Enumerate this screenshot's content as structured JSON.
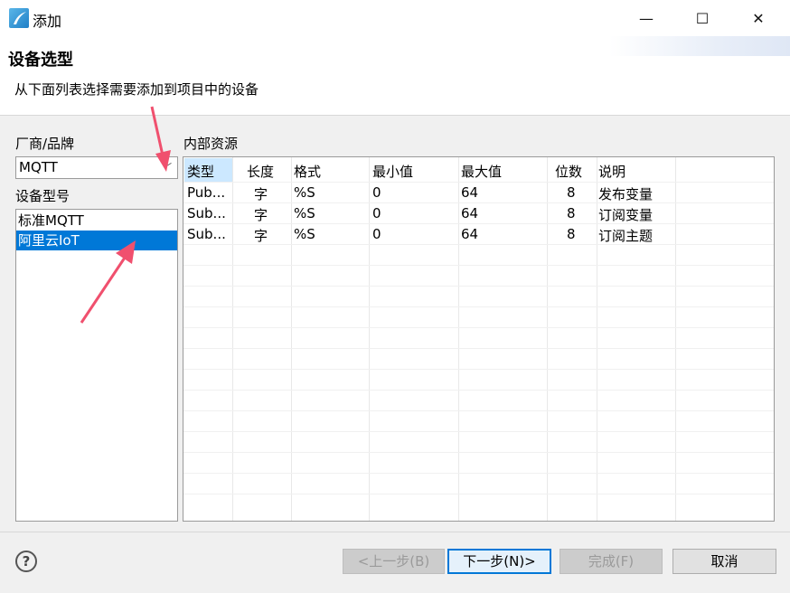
{
  "window": {
    "title": "添加",
    "min": "—",
    "max": "☐",
    "close": "✕"
  },
  "header": {
    "title": "设备选型",
    "description": "从下面列表选择需要添加到项目中的设备"
  },
  "vendor": {
    "label": "厂商/品牌",
    "selected": "MQTT"
  },
  "model": {
    "label": "设备型号",
    "items": [
      "标准MQTT",
      "阿里云IoT"
    ],
    "selected_index": 1
  },
  "resources": {
    "label": "内部资源",
    "columns": [
      "类型",
      "长度",
      "格式",
      "最小值",
      "最大值",
      "位数",
      "说明"
    ],
    "rows": [
      [
        "Pub...",
        "字",
        "%S",
        "0",
        "64",
        "8",
        "发布变量"
      ],
      [
        "Sub...",
        "字",
        "%S",
        "0",
        "64",
        "8",
        "订阅变量"
      ],
      [
        "Sub...",
        "字",
        "%S",
        "0",
        "64",
        "8",
        "订阅主题"
      ]
    ]
  },
  "footer": {
    "help": "?",
    "back_label": "<上一步(B)",
    "next_label": "下一步(N)>",
    "finish_label": "完成(F)",
    "cancel_label": "取消"
  },
  "colors": {
    "selection": "#0078d7",
    "header_selection": "#cce8ff",
    "annotation_arrow": "#f0506e"
  }
}
